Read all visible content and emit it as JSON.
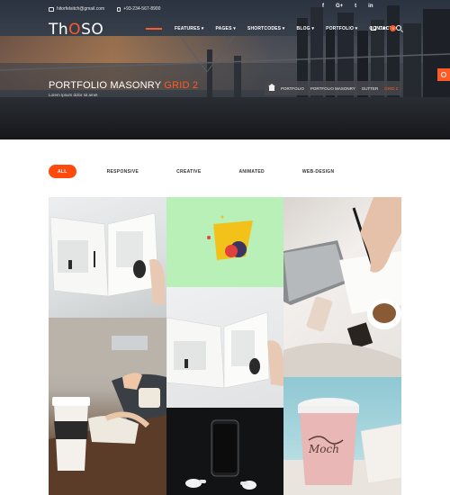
{
  "topbar": {
    "email": "hitorfelsitch@gmail.com",
    "phone": "+93-234-567-8900"
  },
  "socials": [
    "f",
    "G+",
    "t",
    "in"
  ],
  "logo": {
    "prefix": "Th",
    "middle": "O",
    "suffix": "SO"
  },
  "nav": {
    "items": [
      "FEATURES ▾",
      "PAGES ▾",
      "SHORTCODES ▾",
      "BLOG ▾",
      "PORTFOLIO ▾",
      "CONTACT ▾"
    ],
    "cart_label": "Cart",
    "cart_count": "0"
  },
  "hero": {
    "title": "PORTFOLIO MASONRY",
    "title_accent": "GRID 2",
    "subtitle": "Lorem Ipsum dolor sit amet"
  },
  "breadcrumb": {
    "items": [
      "PORTFOLIO",
      "PORTFOLIO MASONRY",
      "GUTTER"
    ],
    "current": "GRID 2"
  },
  "filters": {
    "items": [
      "ALL",
      "RESPONSIVE",
      "CREATIVE",
      "ANIMATED",
      "WEB-DESIGN"
    ],
    "active_index": 0
  },
  "colors": {
    "accent": "#ff4a0e",
    "tile_green": "#b8f0b7"
  },
  "icons": [
    "mail-icon",
    "phone-icon",
    "home-icon",
    "cart-icon",
    "search-icon",
    "settings-icon"
  ],
  "portfolio": {
    "tiles": [
      {
        "name": "open-book-mockup"
      },
      {
        "name": "abstract-shapes"
      },
      {
        "name": "laptop-notebook-coffee"
      },
      {
        "name": "open-book-mockup-2"
      },
      {
        "name": "coffee-cup-desk"
      },
      {
        "name": "phone-earbuds"
      },
      {
        "name": "mocha-cup"
      }
    ]
  }
}
